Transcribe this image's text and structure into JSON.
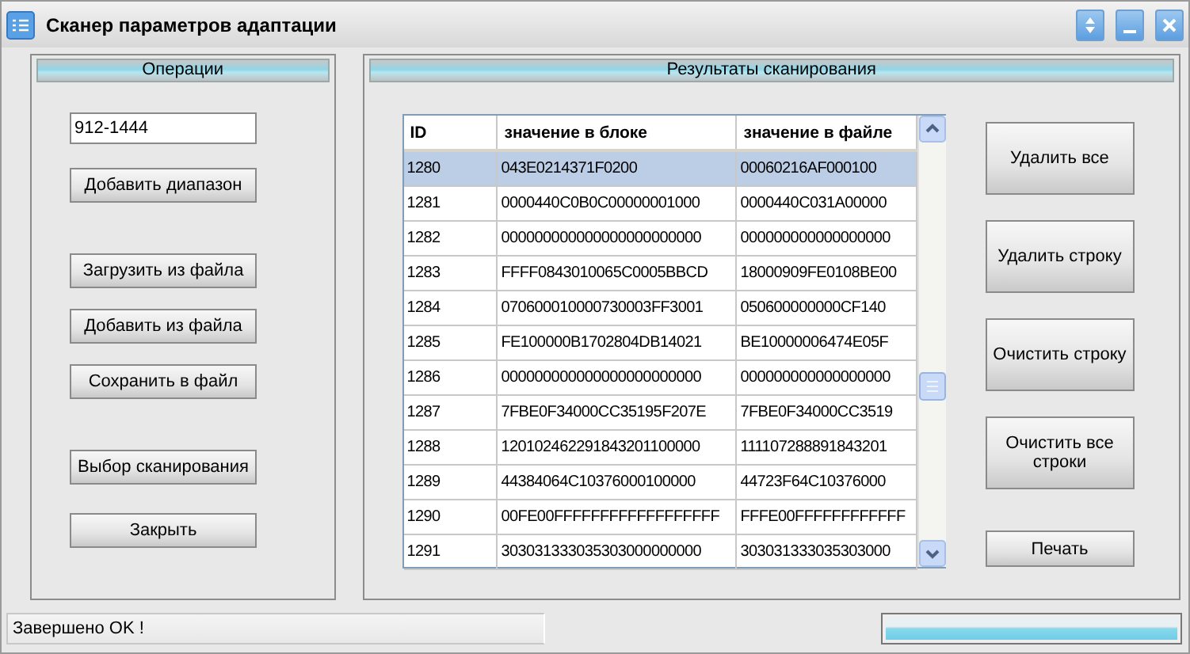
{
  "window": {
    "title": "Сканер параметров адаптации"
  },
  "operations": {
    "title": "Операции",
    "range_field": {
      "value": "912-1444"
    },
    "button_groups": [
      [
        "Добавить диапазон"
      ],
      [
        "Загрузить из файла",
        "Добавить из файла",
        "Сохранить в файл"
      ],
      [
        "Выбор сканирования",
        "Закрыть"
      ]
    ]
  },
  "results": {
    "title": "Результаты сканирования",
    "table": {
      "columns": [
        "ID",
        "значение в блоке",
        "значение в файле"
      ],
      "rows": [
        {
          "cells": [
            "1280",
            "043E0214371F0200",
            "00060216AF000100"
          ],
          "selected": true
        },
        {
          "cells": [
            "1281",
            "0000440C0B0C00000001000",
            "0000440C031A00000"
          ],
          "selected": false
        },
        {
          "cells": [
            "1282",
            "000000000000000000000000",
            "000000000000000000"
          ],
          "selected": false
        },
        {
          "cells": [
            "1283",
            "FFFF0843010065C0005BBCD",
            "18000909FE0108BE00"
          ],
          "selected": false
        },
        {
          "cells": [
            "1284",
            "070600010000730003FF3001",
            "050600000000CF140"
          ],
          "selected": false
        },
        {
          "cells": [
            "1285",
            "FE100000B1702804DB14021",
            "BE10000006474E05F"
          ],
          "selected": false
        },
        {
          "cells": [
            "1286",
            "000000000000000000000000",
            "000000000000000000"
          ],
          "selected": false
        },
        {
          "cells": [
            "1287",
            "7FBE0F34000CC35195F207E",
            "7FBE0F34000CC3519"
          ],
          "selected": false
        },
        {
          "cells": [
            "1288",
            "120102462291843201100000",
            "111107288891843201"
          ],
          "selected": false
        },
        {
          "cells": [
            "1289",
            "44384064C10376000100000",
            "44723F64C10376000"
          ],
          "selected": false
        },
        {
          "cells": [
            "1290",
            "00FE00FFFFFFFFFFFFFFFFFF",
            "FFFE00FFFFFFFFFFFF"
          ],
          "selected": false
        },
        {
          "cells": [
            "1291",
            "303031333035303000000000",
            "303031333035303000"
          ],
          "selected": false
        }
      ]
    },
    "buttons": [
      {
        "label": "Удалить все",
        "kind": "large"
      },
      {
        "label": "Удалить строку",
        "kind": "large"
      },
      {
        "label": "Очистить строку",
        "kind": "large"
      },
      {
        "label": "Очистить все строки",
        "kind": "large"
      },
      {
        "label": "Печать",
        "kind": "small"
      }
    ]
  },
  "status_bar": {
    "message": "Завершено OK !",
    "progress": {
      "level": 1
    }
  }
}
